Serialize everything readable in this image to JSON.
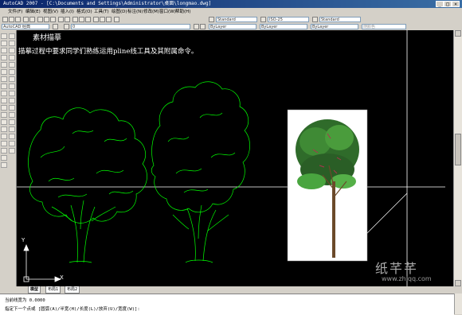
{
  "window": {
    "title": "AutoCAD 2007 - [C:\\Documents and Settings\\Administrator\\桌面\\longmao.dwg]"
  },
  "menu": {
    "items": [
      "文件(F)",
      "编辑(E)",
      "视图(V)",
      "插入(I)",
      "格式(O)",
      "工具(T)",
      "绘图(D)",
      "标注(N)",
      "修改(M)",
      "窗口(W)",
      "帮助(H)"
    ]
  },
  "toolbar": {
    "text_style": "Standard",
    "dim_style": "ISO-25",
    "table_style": "Standard",
    "workspace": "AutoCAD 经典",
    "layer": "0",
    "color": "ByLayer",
    "linetype": "ByLayer",
    "lineweight": "ByLayer",
    "plotstyle": "随颜色"
  },
  "drawing": {
    "heading": "素材描摹",
    "instruction": "描摹过程中要求同学们熟练运用pline线工具及其附属命令。",
    "ucs_x": "X",
    "ucs_y": "Y"
  },
  "tabs": [
    "模型",
    "布局1",
    "布局2"
  ],
  "command": {
    "line1": "当前线宽为 0.0000",
    "line2": "指定下一个点或 [圆弧(A)/半宽(H)/长度(L)/放弃(U)/宽度(W)]:"
  },
  "watermark": {
    "brand": "纸芊芊",
    "url": "www.zhiqq.com"
  },
  "colors": {
    "canvas": "#000000",
    "linework": "#00ff00",
    "titlebar": "#0a246a"
  }
}
